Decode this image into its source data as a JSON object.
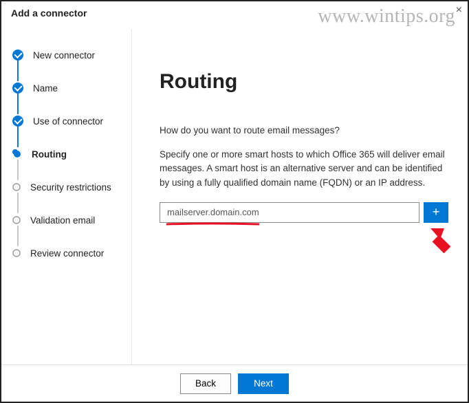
{
  "watermark": "www.wintips.org",
  "header": {
    "title": "Add a connector"
  },
  "sidebar": {
    "steps": [
      {
        "label": "New connector",
        "state": "completed"
      },
      {
        "label": "Name",
        "state": "completed"
      },
      {
        "label": "Use of connector",
        "state": "completed"
      },
      {
        "label": "Routing",
        "state": "current"
      },
      {
        "label": "Security restrictions",
        "state": "pending"
      },
      {
        "label": "Validation email",
        "state": "pending"
      },
      {
        "label": "Review connector",
        "state": "pending"
      }
    ]
  },
  "main": {
    "title": "Routing",
    "question": "How do you want to route email messages?",
    "description": "Specify one or more smart hosts to which Office 365 will deliver email messages. A smart host is an alternative server and can be identified by using a fully qualified domain name (FQDN) or an IP address.",
    "input_value": "mailserver.domain.com",
    "add_icon": "+"
  },
  "footer": {
    "back": "Back",
    "next": "Next"
  }
}
